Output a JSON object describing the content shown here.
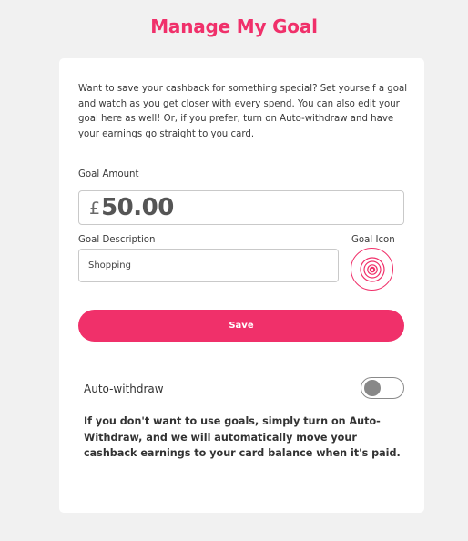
{
  "header": {
    "title": "Manage My Goal"
  },
  "card": {
    "intro": "Want to save your cashback for something special? Set yourself a goal and watch as you get closer with every spend. You can also edit your goal here as well! Or, if you prefer, turn on Auto-withdraw and have your earnings go straight to you card.",
    "goal_amount": {
      "label": "Goal Amount",
      "currency_symbol": "£",
      "value": "50.00"
    },
    "goal_description": {
      "label": "Goal Description",
      "value": "Shopping"
    },
    "goal_icon": {
      "label": "Goal Icon",
      "icon": "target-icon"
    },
    "save_label": "Save",
    "auto_withdraw": {
      "label": "Auto-withdraw",
      "enabled": false,
      "description": "If you don't want to use goals, simply turn on Auto-Withdraw, and we will automatically move your cashback earnings to your card balance when it's paid."
    }
  },
  "colors": {
    "accent": "#f0306a",
    "background": "#f1f1f1",
    "card": "#ffffff",
    "toggle_knob_off": "#888888"
  }
}
